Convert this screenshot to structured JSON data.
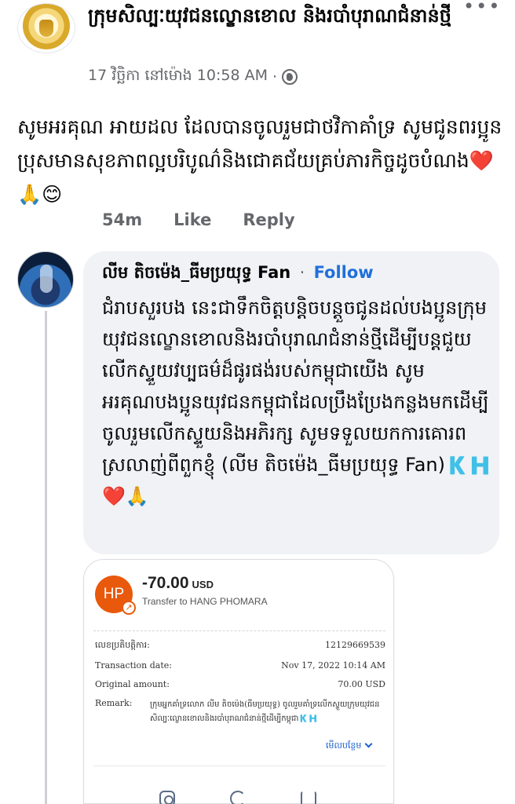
{
  "post": {
    "page_name": "ក្រុមសិល្បៈយុវជនល្ខោនខោល និងរបាំបុរាណជំនាន់ថ្មី",
    "timestamp": "17 វិច្ឆិកា នៅម៉ោង 10:58 AM",
    "separator": "·",
    "more_icon_label": "•••",
    "text": "សូមអរគុណ អាយដល ដែលបានចូលរួមជាថវិកាគាំទ្រ សូមជូនពរប្អូនប្រុសមានសុខភាពល្អបរិបូណ៌និងជោគជ័យគ្រប់ភារកិច្ចដូចបំណង❤️🙏😊",
    "age": "54m",
    "like_label": "Like",
    "reply_label": "Reply"
  },
  "comment": {
    "author": "លីម តិចម៉េង_ធីមប្រយុទ្ធ Fan",
    "separator": "·",
    "follow_label": "Follow",
    "text": "ជំរាបសួរបង នេះជាទឹកចិត្តបន្តិចបន្តួចជូនដល់បងប្អូនក្រុមយុវជនល្ខោនខោលនិងរបាំបុរាណជំនាន់ថ្មីដើម្បីបន្តជួយលើកស្ទួយវប្បធម៌ដ៏ផូរផង់របស់កម្ពុជាយើង សូមអរគុណបងប្អូនយុវជនកម្ពុជាដែលប្រឹងប្រែងកន្លងមកដើម្បីចូលរួមលើកស្ទួយនិងអភិរក្ស សូមទទួលយកការគោរពស្រលាញ់ពីពួកខ្ញុំ (លីម តិចម៉េង_ធីមប្រយុទ្ធ Fan)🇰🇭❤️🙏"
  },
  "receipt": {
    "avatar_initials": "HP",
    "amount": "-70.00",
    "currency": "USD",
    "transfer_to": "Transfer to HANG PHOMARA",
    "rows": [
      {
        "label": "លេខប្រតិបត្តិការ:",
        "value": "12129669539"
      },
      {
        "label": "Transaction date:",
        "value": "Nov 17, 2022 10:14 AM"
      },
      {
        "label": "Original amount:",
        "value": "70.00 USD"
      }
    ],
    "remark_label": "Remark:",
    "remark_value": "ក្រុមអ្នកគាំទ្រលោក លីម តិចម៉េង(ធីមប្រយុទ្ធ) ចូលរួមគាំទ្រលើកស្ទួយក្រុមយុវជនសិល្បៈល្ខោនខោលនិងរបាំបុរាណជំនាន់ថ្មីដើម្បីកម្ពុជា🇰🇭",
    "see_more_label": "មើលបន្ថែម"
  },
  "colors": {
    "link_blue": "#216fdb",
    "secondary_text": "#65676b",
    "bubble_bg": "#f0f2f5",
    "receipt_avatar": "#e8590c"
  },
  "icons": [
    "more-icon",
    "globe-icon",
    "transfer-arrow-icon",
    "chevron-down-icon",
    "scan-icon",
    "repeat-icon",
    "share-icon"
  ]
}
